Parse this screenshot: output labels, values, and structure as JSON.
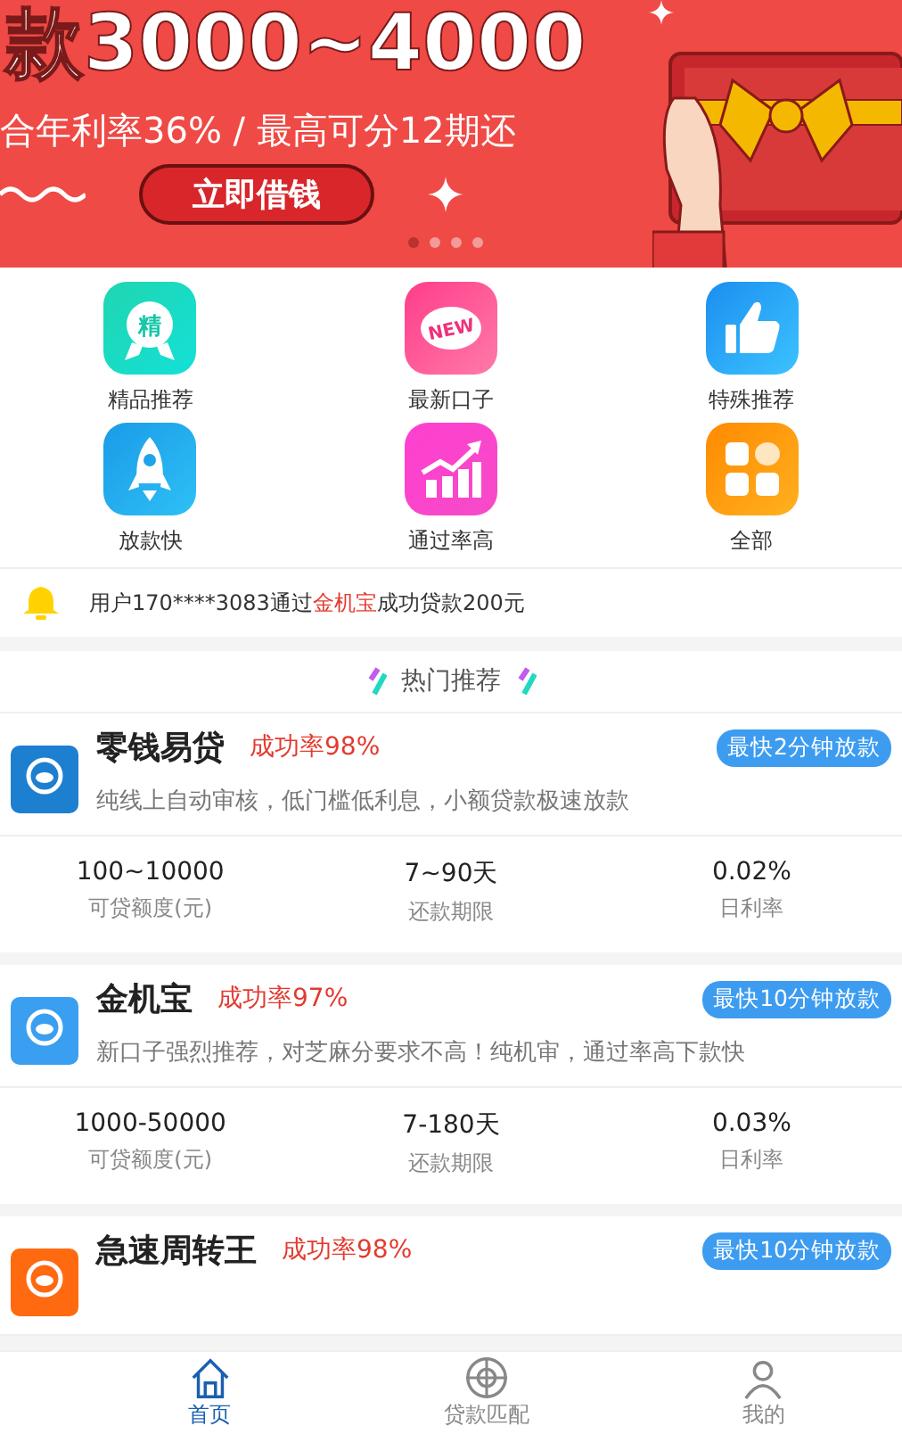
{
  "banner": {
    "headline": "款3000~4000",
    "subline": "合年利率36% / 最高可分12期还",
    "button": "立即借钱",
    "dots": [
      {
        "selected": true
      },
      {
        "selected": false
      },
      {
        "selected": false
      },
      {
        "selected": false
      }
    ]
  },
  "categories": [
    {
      "label": "精品推荐",
      "kind": "quality",
      "icon_text": "精"
    },
    {
      "label": "最新口子",
      "kind": "new",
      "icon_text": "NEW"
    },
    {
      "label": "特殊推荐",
      "kind": "thumb"
    },
    {
      "label": "放款快",
      "kind": "rocket"
    },
    {
      "label": "通过率高",
      "kind": "chart"
    },
    {
      "label": "全部",
      "kind": "all"
    }
  ],
  "notice": {
    "parts": [
      {
        "text": "用户170****3083通过",
        "highlight": false
      },
      {
        "text": "金机宝",
        "highlight": true
      },
      {
        "text": "成功贷款200元",
        "highlight": false
      }
    ]
  },
  "section_title": "热门推荐",
  "products": [
    {
      "name": "零钱易贷",
      "rate": "成功率98%",
      "badge": "最快2分钟放款",
      "color": "#1d7fd0",
      "description": "纯线上自动审核，低门槛低利息，小额贷款极速放款",
      "stats": [
        {
          "value": "100~10000",
          "label": "可贷额度(元)"
        },
        {
          "value": "7~90天",
          "label": "还款期限"
        },
        {
          "value": "0.02%",
          "label": "日利率"
        }
      ]
    },
    {
      "name": "金机宝",
      "rate": "成功率97%",
      "badge": "最快10分钟放款",
      "color": "#3a9ff0",
      "description": "新口子强烈推荐，对芝麻分要求不高！纯机审，通过率高下款快",
      "stats": [
        {
          "value": "1000-50000",
          "label": "可贷额度(元)"
        },
        {
          "value": "7-180天",
          "label": "还款期限"
        },
        {
          "value": "0.03%",
          "label": "日利率"
        }
      ]
    },
    {
      "name": "急速周转王",
      "rate": "成功率98%",
      "badge": "最快10分钟放款",
      "color": "#ff6a10"
    }
  ],
  "tabs": [
    {
      "label": "首页",
      "kind": "home",
      "selected": true
    },
    {
      "label": "贷款匹配",
      "kind": "target",
      "selected": false
    },
    {
      "label": "我的",
      "kind": "user",
      "selected": false
    }
  ]
}
